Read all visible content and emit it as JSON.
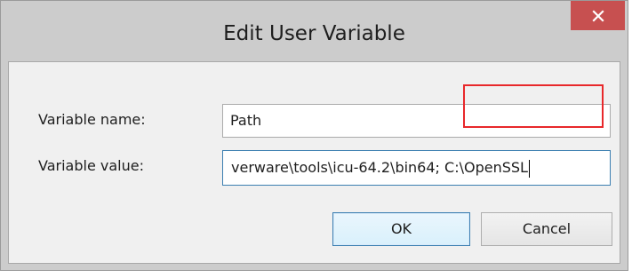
{
  "dialog": {
    "title": "Edit User Variable",
    "close_label": "×"
  },
  "form": {
    "name_label": "Variable name:",
    "name_value": "Path",
    "value_label": "Variable value:",
    "value_value": "verware\\tools\\icu-64.2\\bin64; C:\\OpenSSL"
  },
  "buttons": {
    "ok": "OK",
    "cancel": "Cancel"
  },
  "colors": {
    "close_button": "#c75050",
    "highlight_box": "#e8282b",
    "focus_border": "#3c7fb1"
  }
}
